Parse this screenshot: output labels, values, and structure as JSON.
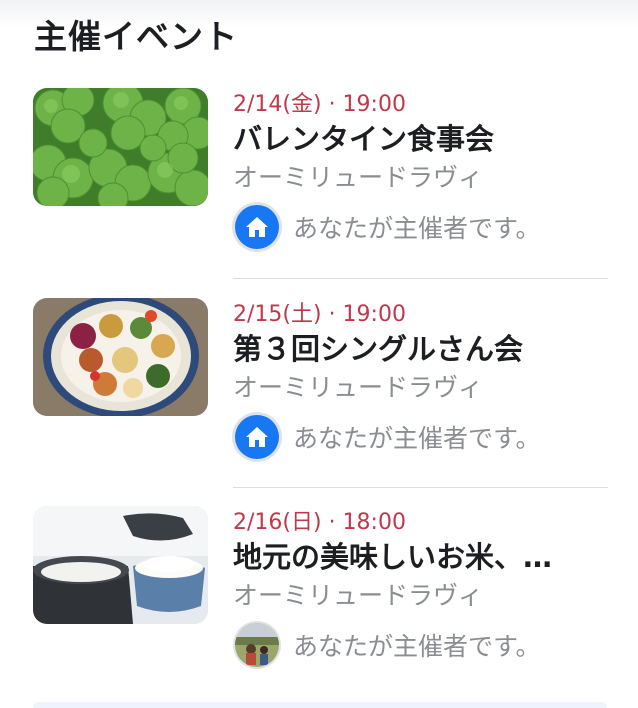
{
  "section": {
    "title": "主催イベント"
  },
  "events": [
    {
      "date": "2/14(金) · 19:00",
      "title": "バレンタイン食事会",
      "organizer": "オーミリュードラヴィ",
      "host_text": "あなたが主催者です。",
      "thumbnail": "clover-leaves-image",
      "host_icon": "home-icon"
    },
    {
      "date": "2/15(土) · 19:00",
      "title": "第３回シングルさん会",
      "organizer": "オーミリュードラヴィ",
      "host_text": "あなたが主催者です。",
      "thumbnail": "food-plate-image",
      "host_icon": "home-icon"
    },
    {
      "date": "2/16(日) · 18:00",
      "title": "地元の美味しいお米、…",
      "organizer": "オーミリュードラヴィ",
      "host_text": "あなたが主催者です。",
      "thumbnail": "rice-cooker-image",
      "host_icon": "profile-photo"
    }
  ],
  "colors": {
    "date": "#c0394a",
    "title": "#1c1e21",
    "secondary": "#8a8d91",
    "host_icon_bg": "#1877f2",
    "divider": "#dadde1"
  }
}
